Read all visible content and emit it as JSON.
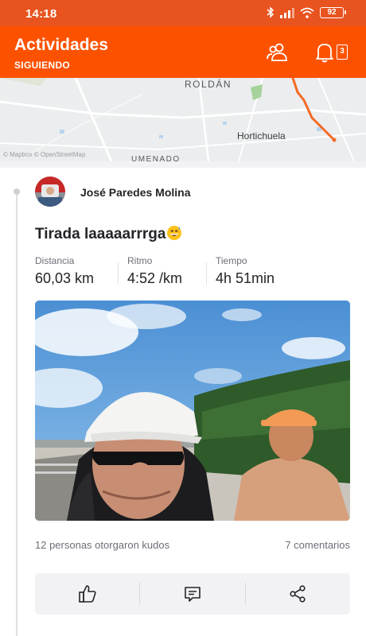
{
  "status_bar": {
    "time": "14:18",
    "battery": "92",
    "icons": [
      "bluetooth-icon",
      "signal-icon",
      "wifi-icon",
      "battery-icon"
    ]
  },
  "header": {
    "title": "Actividades",
    "subtitle": "SIGUIENDO",
    "notification_count": "3",
    "icons": [
      "people-icon",
      "bell-icon"
    ]
  },
  "map": {
    "labels": {
      "roldan": "ROLDÁN",
      "hortichuela": "Hortichuela",
      "partial_label": "UMENADO",
      "credit": "© Mapbox © OpenStreetMap"
    }
  },
  "activity": {
    "athlete_name": "José Paredes Molina",
    "title": "Tirada laaaaarrrga",
    "title_emoji": "grinning-sweat-emoji",
    "stats": [
      {
        "label": "Distancia",
        "value": "60,03 km"
      },
      {
        "label": "Ritmo",
        "value": "4:52 /km"
      },
      {
        "label": "Tiempo",
        "value": "4h 51min"
      }
    ],
    "kudos_text": "12 personas otorgaron kudos",
    "comments_text": "7 comentarios"
  },
  "actions": {
    "icons": [
      "kudos-thumb-icon",
      "comment-icon",
      "share-icon"
    ]
  },
  "colors": {
    "brand": "#fc5200",
    "status_bar": "#e8531f",
    "route": "#f46a25"
  }
}
